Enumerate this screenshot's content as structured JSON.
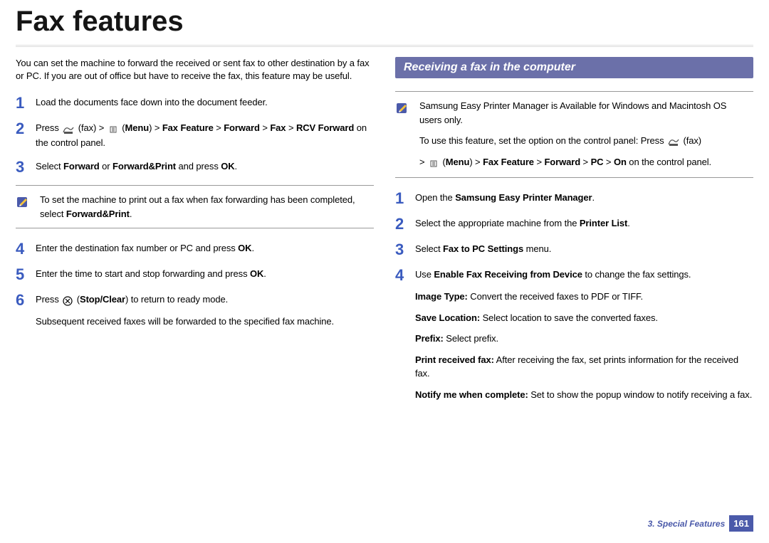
{
  "title": "Fax features",
  "intro": "You can set the machine to forward the received or sent fax to other destination by a fax or PC. If you are out of office but have to receive the fax, this feature may be useful.",
  "left_steps": {
    "s1": "Load the documents face down into the document feeder.",
    "s2_pre": "Press ",
    "s2_fax": " (fax) > ",
    "s2_menu_pre": " (",
    "s2_menu": "Menu",
    "s2_menu_post": ") > ",
    "s2_path": "Fax Feature",
    "s2_gt1": " > ",
    "s2_fwd": "Forward",
    "s2_gt2": " > ",
    "s2_faxb": "Fax",
    "s2_gt3": " > ",
    "s2_rcv": "RCV Forward",
    "s2_end": " on the control panel.",
    "s3_a": "Select ",
    "s3_b": "Forward",
    "s3_c": " or ",
    "s3_d": "Forward&Print",
    "s3_e": " and press ",
    "s3_f": "OK",
    "s3_g": ".",
    "s4_a": "Enter the destination fax number or PC and press ",
    "s4_b": "OK",
    "s4_c": ".",
    "s5_a": "Enter the time to start and stop forwarding and press ",
    "s5_b": "OK",
    "s5_c": ".",
    "s6_a": "Press ",
    "s6_b": " (",
    "s6_c": "Stop/Clear",
    "s6_d": ") to return to ready mode.",
    "s6_tail": "Subsequent received faxes will be forwarded to the specified fax machine."
  },
  "left_note_a": "To set the machine to print out a fax when fax forwarding has been completed, select ",
  "left_note_b": "Forward&Print",
  "left_note_c": ".",
  "section_heading": "Receiving a fax in the computer",
  "right_note": {
    "l1": "Samsung Easy Printer Manager is Available for Windows and Macintosh OS users only.",
    "l2_a": "To use this feature, set the option on the control panel: Press ",
    "l2_b": " (fax) ",
    "l3_a": "> ",
    "l3_b": " (",
    "l3_c": "Menu",
    "l3_d": ") > ",
    "l3_e": "Fax Feature",
    "l3_f": " > ",
    "l3_g": "Forward",
    "l3_h": " > ",
    "l3_i": "PC",
    "l3_j": " > ",
    "l3_k": "On",
    "l3_l": " on the control panel."
  },
  "right_steps": {
    "s1_a": "Open the ",
    "s1_b": "Samsung Easy Printer Manager",
    "s1_c": ".",
    "s2_a": "Select the appropriate machine from the ",
    "s2_b": "Printer List",
    "s2_c": ".",
    "s3_a": "Select ",
    "s3_b": "Fax to PC Settings",
    "s3_c": " menu.",
    "s4_a": "Use ",
    "s4_b": "Enable Fax Receiving from Device",
    "s4_c": " to change the fax settings.",
    "b1_a": "Image Type:",
    "b1_b": " Convert the received faxes to PDF or TIFF.",
    "b2_a": "Save Location:",
    "b2_b": " Select location to save the converted faxes.",
    "b3_a": "Prefix:",
    "b3_b": " Select prefix.",
    "b4_a": "Print received fax:",
    "b4_b": " After receiving the fax, set prints information for the received fax.",
    "b5_a": "Notify me when complete: ",
    "b5_b": " Set to show the popup window to notify receiving a fax."
  },
  "footer": {
    "chapter": "3.  Special Features",
    "page": "161"
  },
  "icons": {
    "fax": "fax-icon",
    "menu": "menu-icon",
    "stop": "stop-clear-icon",
    "note": "note-pencil-icon"
  }
}
